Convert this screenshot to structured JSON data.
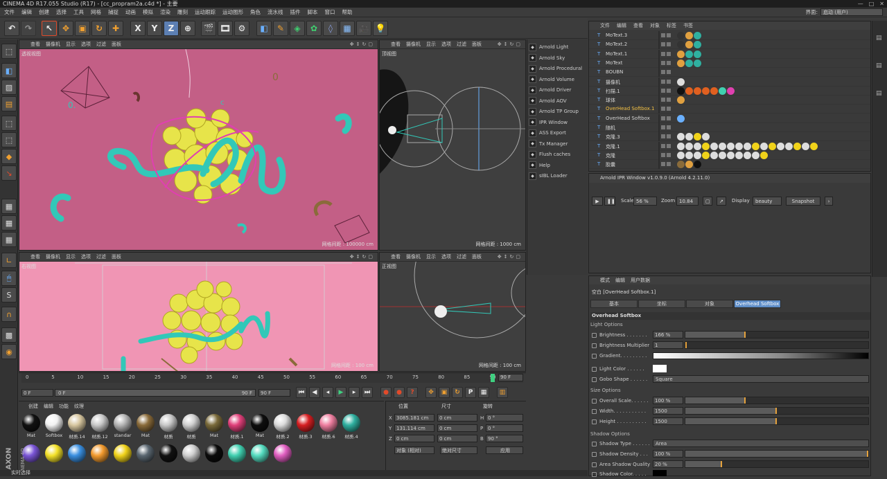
{
  "window": {
    "title": "CINEMA 4D R17.055 Studio (R17) - [cc_propram2a.c4d *] - 主要",
    "controls": [
      "—",
      "□",
      "✕"
    ]
  },
  "menubar": {
    "items": [
      "文件",
      "编辑",
      "创建",
      "选择",
      "工具",
      "网格",
      "捕捉",
      "动画",
      "模拟",
      "渲染",
      "雕刻",
      "运动跟踪",
      "运动图形",
      "角色",
      "流水线",
      "插件",
      "脚本",
      "窗口",
      "帮助"
    ],
    "layout_label": "界面:",
    "layout_value": "启动 (用户)"
  },
  "toolbar": {
    "x_label": "X",
    "y_label": "Y",
    "z_label": "Z"
  },
  "viewports": [
    {
      "menu": [
        "查看",
        "摄像机",
        "显示",
        "选项",
        "过滤",
        "面板"
      ],
      "label": "透视视图",
      "grid": "网格间距 : 100000 cm"
    },
    {
      "menu": [
        "查看",
        "摄像机",
        "显示",
        "选项",
        "过滤",
        "面板"
      ],
      "label": "顶视图",
      "grid": "网格间距 : 1000 cm"
    },
    {
      "menu": [
        "查看",
        "摄像机",
        "显示",
        "选项",
        "过滤",
        "面板"
      ],
      "label": "右视图",
      "grid": "网格间距 : 100 cm"
    },
    {
      "menu": [
        "查看",
        "摄像机",
        "显示",
        "选项",
        "过滤",
        "面板"
      ],
      "label": "正视图",
      "grid": "网格间距 : 100 cm"
    }
  ],
  "plugin_menu": [
    {
      "label": "Arnold Light",
      "icon": "light-icon"
    },
    {
      "label": "Arnold Sky",
      "icon": "sky-icon"
    },
    {
      "label": "Arnold Procedural",
      "icon": "procedural-icon"
    },
    {
      "label": "Arnold Volume",
      "icon": "volume-icon"
    },
    {
      "label": "Arnold Driver",
      "icon": "driver-icon"
    },
    {
      "label": "Arnold AOV",
      "icon": "aov-icon"
    },
    {
      "label": "Arnold TP Group",
      "icon": "tp-group-icon"
    },
    {
      "label": "IPR Window",
      "icon": "ipr-icon"
    },
    {
      "label": "ASS Export",
      "icon": "ass-export-icon"
    },
    {
      "label": "Tx Manager",
      "icon": "tx-manager-icon"
    },
    {
      "label": "Flush caches",
      "icon": "flush-icon"
    },
    {
      "label": "Help",
      "icon": "help-icon"
    },
    {
      "label": "sIBL Loader",
      "icon": "sibl-icon"
    }
  ],
  "object_manager": {
    "menu": [
      "文件",
      "编辑",
      "查看",
      "对象",
      "标签",
      "书签"
    ],
    "objects": [
      {
        "name": "MoText.3",
        "highlight": false
      },
      {
        "name": "MoText.2",
        "highlight": false
      },
      {
        "name": "MoText.1",
        "highlight": false
      },
      {
        "name": "MoText",
        "highlight": false
      },
      {
        "name": "BOUBN",
        "highlight": false
      },
      {
        "name": "摄像机",
        "highlight": false
      },
      {
        "name": "扫描.1",
        "highlight": false
      },
      {
        "name": "球体",
        "highlight": false
      },
      {
        "name": "OverHead Softbox.1",
        "highlight": true
      },
      {
        "name": "OverHead Softbox",
        "highlight": false
      },
      {
        "name": "随机",
        "highlight": false
      },
      {
        "name": "克隆.3",
        "highlight": false
      },
      {
        "name": "克隆.1",
        "highlight": false
      },
      {
        "name": "克隆",
        "highlight": false
      },
      {
        "name": "胶囊",
        "highlight": false
      }
    ]
  },
  "ipr": {
    "title": "Arnold IPR Window v1.0.9.0 (Arnold 4.2.11.0)",
    "scale_label": "Scale",
    "scale_value": "56 %",
    "zoom_label": "Zoom",
    "zoom_value": "10.84",
    "display_label": "Display",
    "display_value": "beauty",
    "snapshot_label": "Snapshot"
  },
  "attributes": {
    "menu": [
      "模式",
      "编辑",
      "用户数据"
    ],
    "object_title": "空白 [OverHead Softbox.1]",
    "tabs": [
      "基本",
      "坐标",
      "对象",
      "Overhead Softbox"
    ],
    "active_tab": 3,
    "section_title": "Overhead Softbox",
    "light_options": "Light Options",
    "brightness_label": "Brightness . . . . . . .",
    "brightness_value": "166 %",
    "brightness_fill": 0.33,
    "brightness_mult_label": "Brightness Multiplier",
    "brightness_mult_value": "1",
    "brightness_mult_fill": 0.0,
    "gradient_label": "Gradient. . . . . . . . .",
    "light_color_label": "Light Color . . . . . .",
    "gobo_label": "Gobo Shape . . . . . .",
    "gobo_value": "Square",
    "size_options": "Size Options",
    "overall_scale_label": "Overall Scale. . . . . .",
    "overall_scale_value": "100 %",
    "overall_scale_fill": 0.33,
    "width_label": "Width. . . . . . . . . . .",
    "width_value": "1500",
    "width_fill": 0.5,
    "height_label": "Height . . . . . . . . . .",
    "height_value": "1500",
    "height_fill": 0.5,
    "shadow_options": "Shadow Options",
    "shadow_type_label": "Shadow Type . . . . . .",
    "shadow_type_value": "Area",
    "shadow_density_label": "Shadow Density . . .",
    "shadow_density_value": "100 %",
    "shadow_density_fill": 1.0,
    "area_shadow_label": "Area Shadow Quality",
    "area_shadow_value": "20 %",
    "area_shadow_fill": 0.2,
    "shadow_color_label": "Shadow Color. . . . ."
  },
  "timeline": {
    "ticks": [
      "0",
      "5",
      "10",
      "15",
      "20",
      "25",
      "30",
      "35",
      "40",
      "45",
      "50",
      "55",
      "60",
      "65",
      "70",
      "75",
      "80",
      "85",
      "90"
    ],
    "current_frame": "90 F",
    "start": "0 F",
    "start2": "0 F",
    "end": "90 F",
    "end2": "90 F"
  },
  "material_manager": {
    "menu": [
      "创建",
      "编辑",
      "功能",
      "纹理"
    ],
    "materials": [
      {
        "name": "Mat",
        "color": "#111111"
      },
      {
        "name": "Softbox",
        "color": "#f2f2f2"
      },
      {
        "name": "材质.14",
        "color": "#d8c7a0"
      },
      {
        "name": "材质.12",
        "color": "#c9c9c9"
      },
      {
        "name": "standar",
        "color": "#b5b5b5"
      },
      {
        "name": "Mat",
        "color": "#8a6b3a"
      },
      {
        "name": "材质",
        "color": "#c8c8c8"
      },
      {
        "name": "材质",
        "color": "#d0d0d0"
      },
      {
        "name": "Mat",
        "color": "#7a6a3a"
      },
      {
        "name": "材质.1",
        "color": "#e0407a"
      },
      {
        "name": "Mat",
        "color": "#0e0e0e"
      },
      {
        "name": "材质.2",
        "color": "#dcdcdc"
      },
      {
        "name": "材质.3",
        "color": "#d61f22"
      },
      {
        "name": "材质.6",
        "color": "#ef7fa0"
      },
      {
        "name": "材质.4",
        "color": "#2fb0a0"
      },
      {
        "name": "",
        "color": "#7a55d6"
      },
      {
        "name": "",
        "color": "#f3e129"
      },
      {
        "name": "",
        "color": "#3a8fe0"
      },
      {
        "name": "",
        "color": "#f29a2e"
      },
      {
        "name": "",
        "color": "#f0d21a"
      },
      {
        "name": "",
        "color": "#5a6670"
      },
      {
        "name": "",
        "color": "#111111"
      },
      {
        "name": "",
        "color": "#cfcfcf"
      },
      {
        "name": "",
        "color": "#0c0c0c"
      },
      {
        "name": "",
        "color": "#40d0b0"
      },
      {
        "name": "",
        "color": "#55dcc0"
      },
      {
        "name": "",
        "color": "#e05ec0"
      }
    ]
  },
  "coordinates": {
    "pos_header": "位置",
    "size_header": "尺寸",
    "rot_header": "旋转",
    "x_label": "X",
    "y_label": "Y",
    "z_label": "Z",
    "x_value": "3085.181 cm",
    "y_value": "131.114 cm",
    "z_value": "0 cm",
    "sx_value": "0 cm",
    "sy_value": "0 cm",
    "sz_value": "0 cm",
    "h_label": "H",
    "p_label": "P",
    "b_label": "B",
    "h_value": "0 °",
    "p_value": "0 °",
    "b_value": "90 °",
    "mode_value": "对象 (相对)",
    "size_mode_value": "绝对尺寸",
    "apply_label": "应用"
  },
  "status": {
    "text": "实时选择",
    "brand": "MAXON",
    "product": "CINEMA 4D"
  }
}
